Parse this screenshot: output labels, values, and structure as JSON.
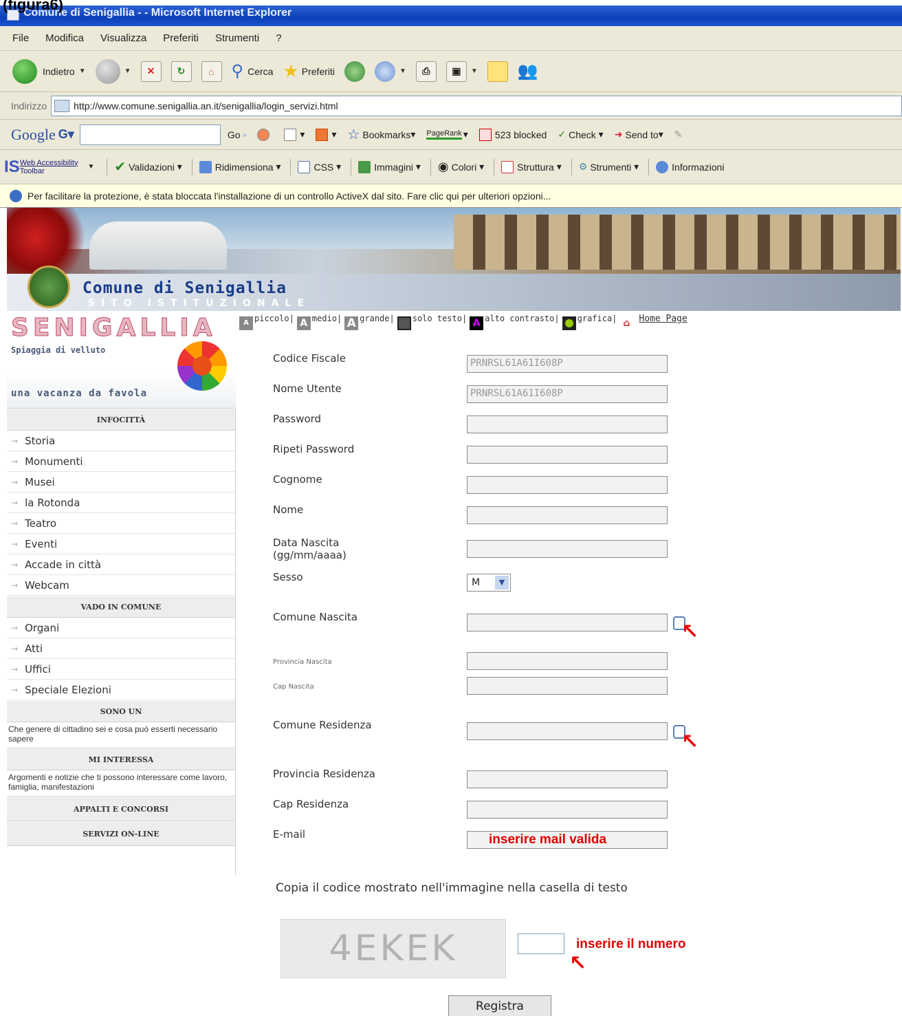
{
  "caption": "(figura6)",
  "window": {
    "title": "Comune di Senigallia - - Microsoft Internet Explorer"
  },
  "menu": [
    "File",
    "Modifica",
    "Visualizza",
    "Preferiti",
    "Strumenti",
    "?"
  ],
  "toolbar": {
    "back": "Indietro",
    "search": "Cerca",
    "favorites": "Preferiti"
  },
  "address": {
    "label": "Indirizzo",
    "url": "http://www.comune.senigallia.an.it/senigallia/login_servizi.html"
  },
  "google": {
    "logo": "Google",
    "go": "Go",
    "bookmarks": "Bookmarks",
    "pagerank": "PageRank",
    "blocked": "523 blocked",
    "check": "Check",
    "sendto": "Send to"
  },
  "wat": {
    "logo_line1": "Web Accessibility",
    "logo_line2": "Toolbar",
    "items": [
      "Validazioni",
      "Ridimensiona",
      "CSS",
      "Immagini",
      "Colori",
      "Struttura",
      "Strumenti",
      "Informazioni"
    ]
  },
  "infobar": {
    "text": "Per facilitare la protezione, è stata bloccata l'installazione di un controllo ActiveX dal sito. Fare clic qui per ulteriori opzioni..."
  },
  "header": {
    "site_name": "Comune  di Senigallia",
    "site_sub": "SITO ISTITUZIONALE"
  },
  "logo": {
    "title": "SENIGALLIA",
    "slogan": "Spiaggia di velluto",
    "tagline": "una vacanza da favola"
  },
  "sidebar": {
    "infocitta": "INFOCITTÀ",
    "infocitta_items": [
      "Storia",
      "Monumenti",
      "Musei",
      "la Rotonda",
      "Teatro",
      "Eventi",
      "Accade in città",
      "Webcam"
    ],
    "vado": "VADO IN COMUNE",
    "vado_items": [
      "Organi",
      "Atti",
      "Uffici",
      "Speciale Elezioni"
    ],
    "sono": "SONO UN",
    "sono_desc": "Che genere di cittadino sei e cosa può esserti necessario sapere",
    "interessa": "MI INTERESSA",
    "interessa_desc": "Argomenti e notizie che ti possono interessare come lavoro, famiglia, manifestazioni",
    "appalti": "APPALTI E CONCORSI",
    "servizi": "SERVIZI ON-LINE"
  },
  "access": {
    "piccolo": "piccolo|",
    "medio": "medio|",
    "grande": "grande|",
    "solo_testo": "solo testo|",
    "alto_contrasto": "alto contrasto|",
    "grafica": "grafica|",
    "home": "Home Page"
  },
  "form": {
    "codice_fiscale": {
      "label": "Codice Fiscale",
      "value": "PRNRSL61A61I608P"
    },
    "nome_utente": {
      "label": "Nome Utente",
      "value": "PRNRSL61A61I608P"
    },
    "password": {
      "label": "Password",
      "value": ""
    },
    "ripeti_password": {
      "label": "Ripeti Password",
      "value": ""
    },
    "cognome": {
      "label": "Cognome",
      "value": ""
    },
    "nome": {
      "label": "Nome",
      "value": ""
    },
    "data_nascita": {
      "label1": "Data Nascita",
      "label2": "(gg/mm/aaaa)",
      "value": ""
    },
    "sesso": {
      "label": "Sesso",
      "value": "M"
    },
    "comune_nascita": {
      "label": "Comune Nascita",
      "value": ""
    },
    "provincia_nascita": {
      "label": "Provincia Nascita",
      "value": ""
    },
    "cap_nascita": {
      "label": "Cap Nascita",
      "value": ""
    },
    "comune_residenza": {
      "label": "Comune Residenza",
      "value": ""
    },
    "provincia_residenza": {
      "label": "Provincia Residenza",
      "value": ""
    },
    "cap_residenza": {
      "label": "Cap Residenza",
      "value": ""
    },
    "email": {
      "label": "E-mail",
      "note": "inserire mail valida"
    },
    "captcha_instruction": "Copia il codice mostrato nell'immagine nella casella di testo",
    "captcha_code": "4EKEK",
    "captcha_note": "inserire il numero",
    "submit": "Registra"
  }
}
